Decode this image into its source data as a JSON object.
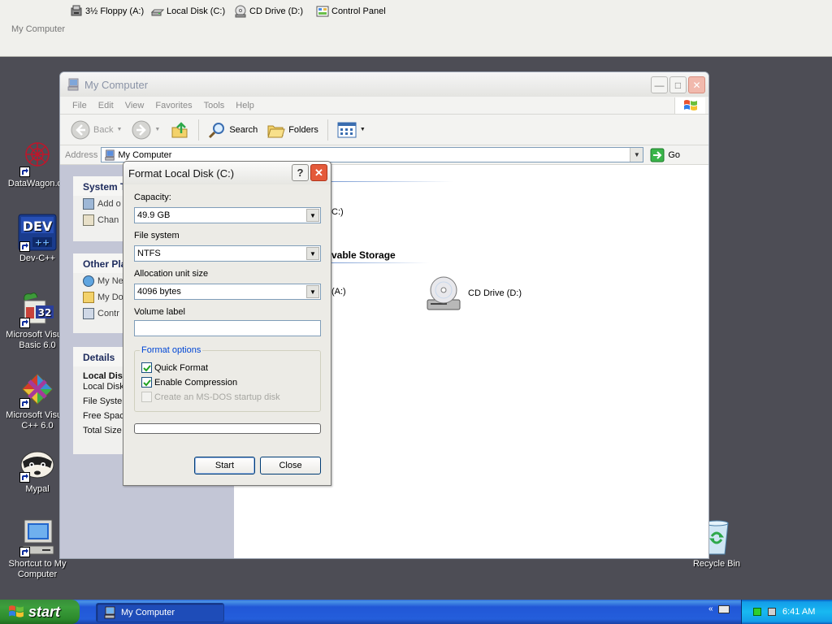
{
  "topbar": {
    "items": [
      {
        "label": "3½ Floppy (A:)",
        "icon": "floppy-drive-icon"
      },
      {
        "label": "Local Disk (C:)",
        "icon": "hard-disk-icon"
      },
      {
        "label": "CD Drive (D:)",
        "icon": "cd-drive-icon"
      },
      {
        "label": "Control Panel",
        "icon": "control-panel-icon"
      }
    ],
    "caption": "My Computer"
  },
  "desktop": {
    "icons": [
      {
        "label": "DataWagon.co",
        "icon": "datawagon-icon"
      },
      {
        "label": "Dev-C++",
        "icon": "dev-cpp-icon"
      },
      {
        "label": "Microsoft Visual Basic 6.0",
        "icon": "visual-basic-icon"
      },
      {
        "label": "Microsoft Visual C++ 6.0",
        "icon": "visual-cpp-icon"
      },
      {
        "label": "Mypal",
        "icon": "mypal-icon"
      },
      {
        "label": "Shortcut to My Computer",
        "icon": "my-computer-icon"
      },
      {
        "label": "Recycle Bin",
        "icon": "recycle-bin-icon"
      }
    ]
  },
  "explorer": {
    "title": "My Computer",
    "menu": [
      "File",
      "Edit",
      "View",
      "Favorites",
      "Tools",
      "Help"
    ],
    "toolbar": {
      "back": "Back",
      "search": "Search",
      "folders": "Folders"
    },
    "address": {
      "label": "Address",
      "value": "My Computer",
      "go": "Go"
    },
    "left_pane": {
      "system_tasks": {
        "title": "System T",
        "items": [
          "Add o",
          "Chan"
        ]
      },
      "other_places": {
        "title": "Other Pla",
        "items": [
          "My Ne",
          "My Do",
          "Contr"
        ]
      },
      "details": {
        "title": "Details",
        "lines": [
          "Local Dis",
          "Local Disk",
          "File System",
          "Free Spac",
          "Total Size"
        ]
      }
    },
    "right_pane": {
      "drive_c_partial": "C:)",
      "removable_header": "vable Storage",
      "floppy_partial": "(A:)",
      "cd_drive": "CD Drive (D:)"
    }
  },
  "format_dialog": {
    "title": "Format Local Disk (C:)",
    "help": "?",
    "capacity": {
      "label": "Capacity:",
      "value": "49.9 GB"
    },
    "file_system": {
      "label": "File system",
      "value": "NTFS"
    },
    "allocation": {
      "label": "Allocation unit size",
      "value": "4096 bytes"
    },
    "volume_label": {
      "label": "Volume label",
      "value": ""
    },
    "format_options": {
      "legend": "Format options",
      "quick_format": {
        "label": "Quick Format",
        "checked": true
      },
      "enable_compression": {
        "label": "Enable Compression",
        "checked": true
      },
      "msdos_startup": {
        "label": "Create an MS-DOS startup disk",
        "checked": false,
        "enabled": false
      }
    },
    "progress": 0,
    "start_label": "Start",
    "close_label": "Close"
  },
  "taskbar": {
    "start_label": "start",
    "task": "My Computer",
    "clock": "6:41 AM"
  },
  "colors": {
    "desktop": "#4d4d55",
    "taskbar": "#245edb",
    "start_button": "#3c9f3c",
    "tray": "#18b9f1",
    "close_button": "#e45a3a",
    "accent_blue": "#0046d5"
  }
}
